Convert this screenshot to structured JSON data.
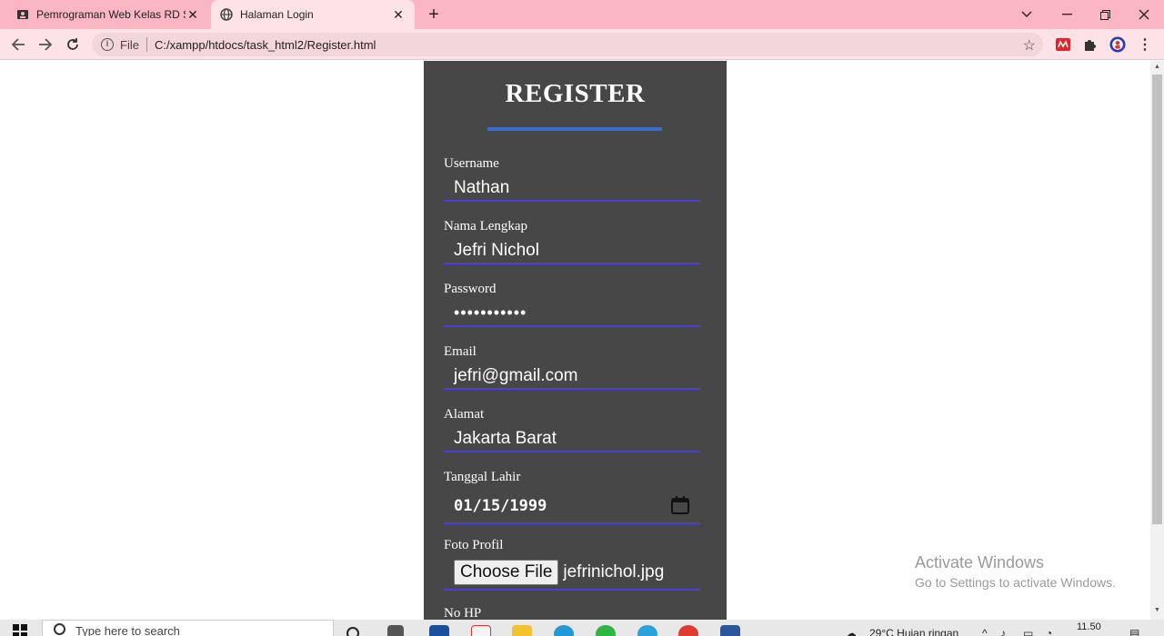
{
  "browser": {
    "tabs": [
      {
        "title": "Pemrograman Web Kelas RD Sem",
        "active": false
      },
      {
        "title": "Halaman Login",
        "active": true
      }
    ],
    "address": {
      "scheme_label": "File",
      "url": "C:/xampp/htdocs/task_html2/Register.html"
    }
  },
  "form": {
    "title": "REGISTER",
    "fields": [
      {
        "label": "Username",
        "value": "Nathan"
      },
      {
        "label": "Nama Lengkap",
        "value": "Jefri Nichol"
      },
      {
        "label": "Password",
        "value": "•••••••••••"
      },
      {
        "label": "Email",
        "value": "jefri@gmail.com"
      },
      {
        "label": "Alamat",
        "value": "Jakarta Barat"
      },
      {
        "label": "Tanggal Lahir",
        "value": "01/15/1999"
      },
      {
        "label": "Foto Profil",
        "button": "Choose File",
        "value": "jefrinichol.jpg"
      },
      {
        "label": "No HP"
      }
    ]
  },
  "watermark": {
    "line1": "Activate Windows",
    "line2": "Go to Settings to activate Windows."
  },
  "taskbar": {
    "search_placeholder": "Type here to search",
    "weather": "29°C Hujan ringan",
    "time": "11.50"
  },
  "colors": {
    "tabbar": "#fbb6c4",
    "toolbar": "#fde2e8",
    "panel": "#474747",
    "title_bar": "#3a6fd0",
    "field_underline": "#4b3fd6"
  }
}
